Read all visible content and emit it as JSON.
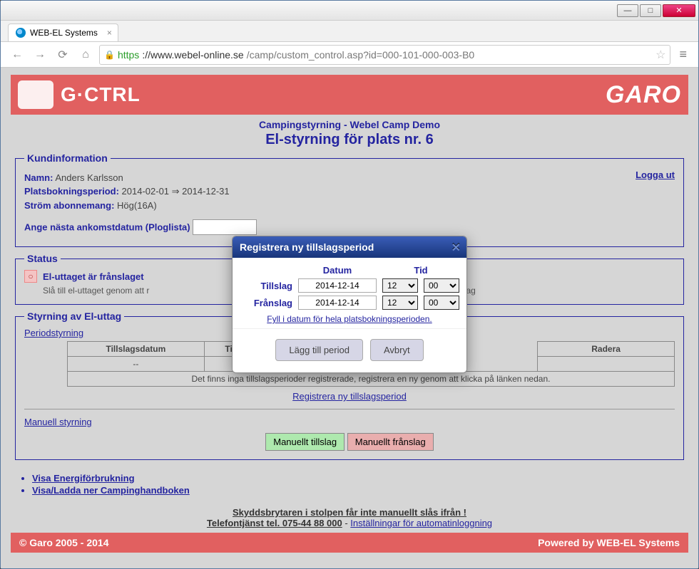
{
  "window": {
    "tab_title": "WEB-EL Systems",
    "url_scheme": "https",
    "url_host": "://www.webel-online.se",
    "url_path": "/camp/custom_control.asp?id=000-101-000-003-B0"
  },
  "banner": {
    "logo_left": "G·CTRL",
    "logo_right": "GARO"
  },
  "header": {
    "subtitle": "Campingstyrning - Webel Camp Demo",
    "title": "El-styrning för plats nr. 6"
  },
  "customer": {
    "legend": "Kundinformation",
    "name_label": "Namn:",
    "name_value": "Anders Karlsson",
    "period_label": "Platsbokningsperiod:",
    "period_value": "2014-02-01 ⇒ 2014-12-31",
    "subscription_label": "Ström abonnemang:",
    "subscription_value": "Hög(16A)",
    "arrival_label": "Ange nästa ankomstdatum (Ploglista)",
    "logout": "Logga ut"
  },
  "status": {
    "legend": "Status",
    "icon_label": "○",
    "state_text": "El-uttaget är frånslaget",
    "help_pre": "Slå till el-uttaget genom att r",
    "help_post": "cka på Manuellt tillslag"
  },
  "control": {
    "legend": "Styrning av El-uttag",
    "period_link": "Periodstyrning",
    "table": {
      "col1": "Tillslagsdatum",
      "col2_partial": "Til",
      "col3": "Radera",
      "empty_cell": "--"
    },
    "no_periods_msg": "Det finns inga tillslagsperioder registrerade, registrera en ny genom att klicka på länken nedan.",
    "register_link": "Registrera ny tillslagsperiod",
    "manual_link": "Manuell styrning",
    "btn_on": "Manuellt tillslag",
    "btn_off": "Manuellt frånslag"
  },
  "dialog": {
    "title": "Registrera ny tillslagsperiod",
    "col_date": "Datum",
    "col_time": "Tid",
    "row_on": "Tillslag",
    "row_off": "Frånslag",
    "date_on": "2014-12-14",
    "date_off": "2014-12-14",
    "hour_on": "12",
    "min_on": "00",
    "hour_off": "12",
    "min_off": "00",
    "fill_link": "Fyll i datum för hela platsbokningsperioden.",
    "btn_add": "Lägg till period",
    "btn_cancel": "Avbryt"
  },
  "footer": {
    "link1": "Visa Energiförbrukning",
    "link2": "Visa/Ladda ner Campinghandboken",
    "warn_bold": "Skyddsbrytaren i stolpen får inte manuellt slås ifrån !",
    "phone_label": "Telefontjänst tel. 075-44 88 000",
    "dash": " - ",
    "settings_link": "Inställningar för automatinloggning",
    "copyright": "© Garo 2005 - 2014",
    "powered": "Powered by WEB-EL Systems"
  }
}
